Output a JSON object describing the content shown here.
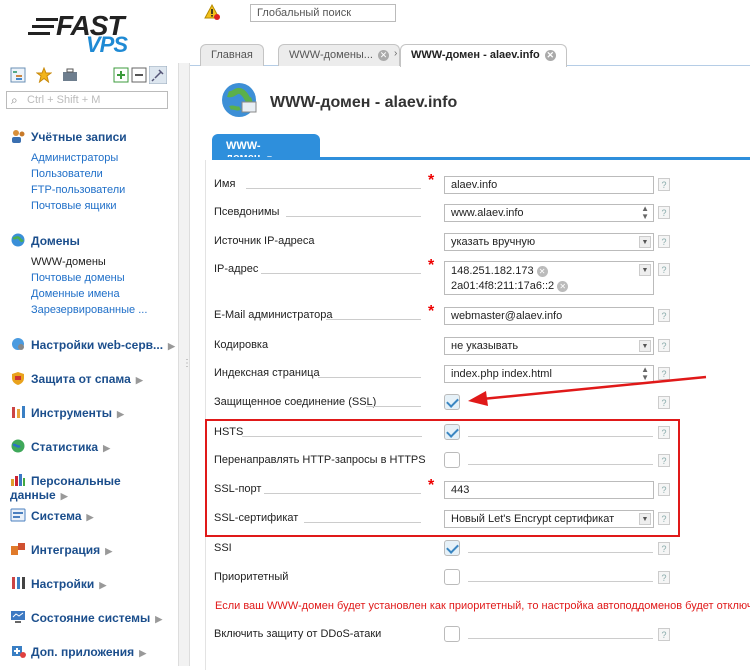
{
  "logo": {
    "fast": "FAST",
    "vps": "VPS"
  },
  "side_search": {
    "placeholder": "Ctrl + Shift + M"
  },
  "global_search": {
    "placeholder": "Глобальный поиск"
  },
  "sidebar": {
    "sections": [
      {
        "label": "Учётные записи",
        "icon": "users-icon",
        "items": [
          "Администраторы",
          "Пользователи",
          "FTP-пользователи",
          "Почтовые ящики"
        ]
      },
      {
        "label": "Домены",
        "icon": "globe-icon",
        "items": [
          "WWW-домены",
          "Почтовые домены",
          "Доменные имена",
          "Зарезервированные ..."
        ],
        "active_item": "WWW-домены"
      },
      {
        "label": "Настройки web-серв...",
        "icon": "web-settings-icon"
      },
      {
        "label": "Защита от спама",
        "icon": "spam-shield-icon"
      },
      {
        "label": "Инструменты",
        "icon": "tools-icon"
      },
      {
        "label": "Статистика",
        "icon": "stats-globe-icon"
      },
      {
        "label": "Персональные данные",
        "icon": "bar-chart-icon"
      },
      {
        "label": "Система",
        "icon": "system-icon"
      },
      {
        "label": "Интеграция",
        "icon": "puzzle-icon"
      },
      {
        "label": "Настройки",
        "icon": "settings-icon"
      },
      {
        "label": "Состояние системы",
        "icon": "monitor-icon"
      },
      {
        "label": "Доп. приложения",
        "icon": "plus-app-icon"
      }
    ]
  },
  "tabs": [
    {
      "label": "Главная"
    },
    {
      "label": "WWW-домены..."
    },
    {
      "label": "WWW-домен - alaev.info",
      "active": true
    }
  ],
  "page": {
    "title": "WWW-домен - alaev.info",
    "form_tab": "WWW-домен"
  },
  "form": {
    "name": {
      "label": "Имя",
      "value": "alaev.info"
    },
    "aliases": {
      "label": "Псевдонимы",
      "value": "www.alaev.info"
    },
    "ip_source": {
      "label": "Источник IP-адреса",
      "value": "указать вручную"
    },
    "ip": {
      "label": "IP-адрес",
      "values": [
        "148.251.182.173",
        "2a01:4f8:211:17a6::2"
      ]
    },
    "email": {
      "label": "E-Mail администратора",
      "value": "webmaster@alaev.info"
    },
    "encoding": {
      "label": "Кодировка",
      "value": "не указывать"
    },
    "index": {
      "label": "Индексная страница",
      "value": "index.php index.html"
    },
    "ssl": {
      "label": "Защищенное соединение (SSL)",
      "checked": true
    },
    "hsts": {
      "label": "HSTS",
      "checked": true
    },
    "redirect": {
      "label": "Перенаправлять HTTP-запросы в HTTPS",
      "checked": false
    },
    "ssl_port": {
      "label": "SSL-порт",
      "value": "443"
    },
    "ssl_cert": {
      "label": "SSL-сертификат",
      "value": "Новый Let's Encrypt сертификат"
    },
    "ssi": {
      "label": "SSI",
      "checked": true
    },
    "priority": {
      "label": "Приоритетный",
      "checked": false
    },
    "priority_warning": "Если ваш WWW-домен будет установлен как приоритетный, то настройка автоподдоменов будет отключена",
    "ddos": {
      "label": "Включить защиту от DDoS-атаки",
      "checked": false
    },
    "help": "?"
  },
  "colors": {
    "accent": "#2e8fdc",
    "highlight": "#e01919",
    "link": "#1f6fc8"
  }
}
